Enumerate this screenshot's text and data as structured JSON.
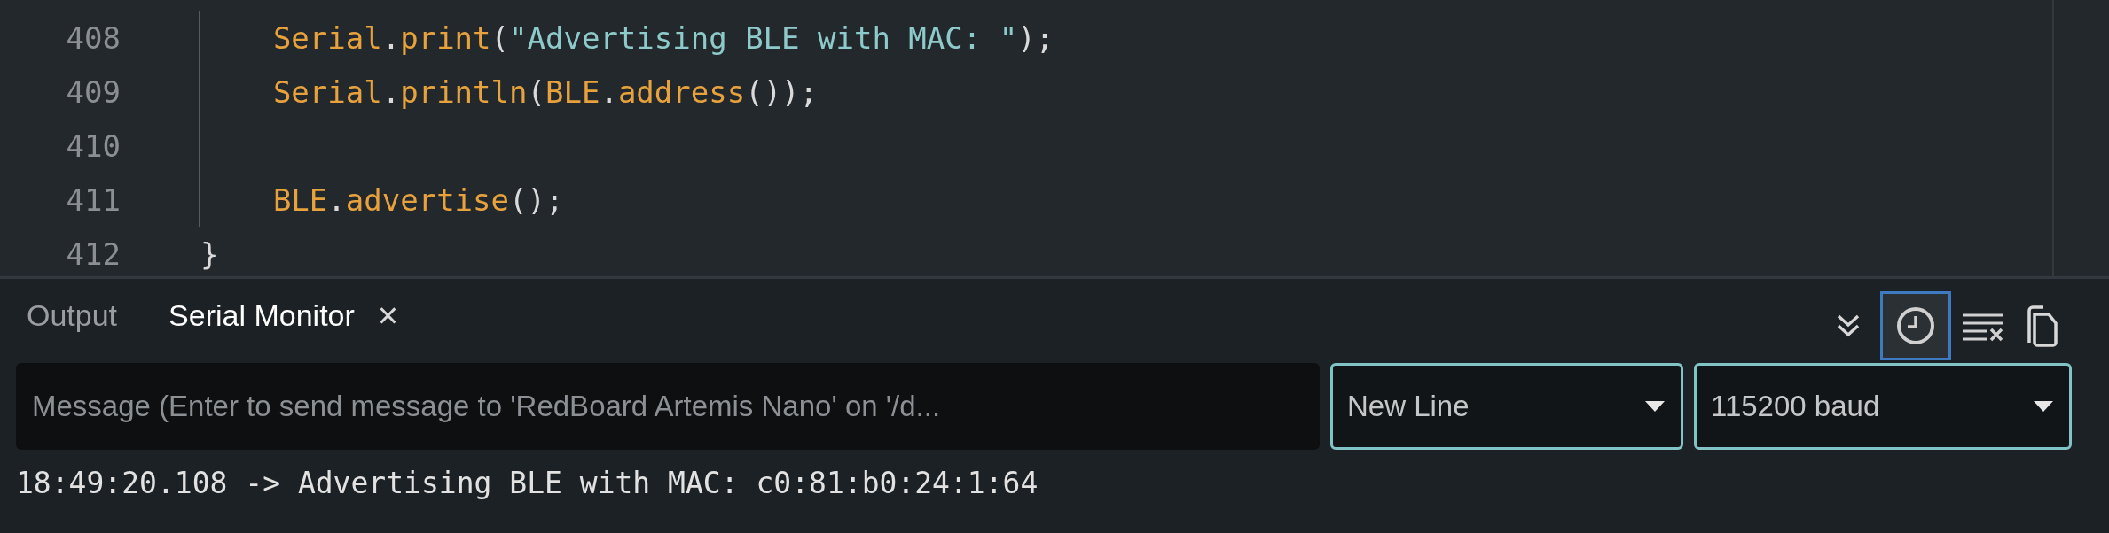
{
  "editor": {
    "lines": [
      {
        "number": "408",
        "tokens": [
          {
            "kind": "ident",
            "text": "    Serial"
          },
          {
            "kind": "punct",
            "text": "."
          },
          {
            "kind": "ident",
            "text": "print"
          },
          {
            "kind": "punct",
            "text": "("
          },
          {
            "kind": "string",
            "text": "\"Advertising BLE with MAC: \""
          },
          {
            "kind": "punct",
            "text": ");"
          }
        ]
      },
      {
        "number": "409",
        "tokens": [
          {
            "kind": "ident",
            "text": "    Serial"
          },
          {
            "kind": "punct",
            "text": "."
          },
          {
            "kind": "ident",
            "text": "println"
          },
          {
            "kind": "punct",
            "text": "("
          },
          {
            "kind": "ident",
            "text": "BLE"
          },
          {
            "kind": "punct",
            "text": "."
          },
          {
            "kind": "ident",
            "text": "address"
          },
          {
            "kind": "punct",
            "text": "());"
          }
        ]
      },
      {
        "number": "410"
      },
      {
        "number": "411",
        "tokens": [
          {
            "kind": "ident",
            "text": "    BLE"
          },
          {
            "kind": "punct",
            "text": "."
          },
          {
            "kind": "ident",
            "text": "advertise"
          },
          {
            "kind": "punct",
            "text": "();"
          }
        ]
      },
      {
        "number": "412",
        "tokens": [
          {
            "kind": "punct",
            "text": "}"
          }
        ]
      }
    ]
  },
  "panel": {
    "tabs": [
      {
        "label": "Output",
        "selected": false
      },
      {
        "label": "Serial Monitor",
        "selected": true,
        "close": "×"
      }
    ],
    "toolbar": [
      {
        "kind": "scroll",
        "selected": false
      },
      {
        "kind": "timestamp",
        "selected": true
      },
      {
        "kind": "clear",
        "selected": false
      },
      {
        "kind": "copy",
        "selected": false
      }
    ],
    "message_field": {
      "placeholder": "Message (Enter to send message to 'RedBoard Artemis Nano' on '/d..."
    },
    "line_ending": {
      "value": "New Line"
    },
    "baud_rate": {
      "value": "115200 baud"
    },
    "output": [
      "18:49:20.108 -> Advertising BLE with MAC: c0:81:b0:24:1:64"
    ]
  }
}
